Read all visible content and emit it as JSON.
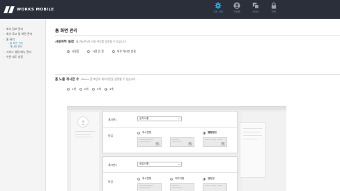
{
  "header": {
    "brand": "WORKS MOBILE",
    "nav": [
      {
        "label": "기본 관리",
        "icon": "gear-icon",
        "active": true
      },
      {
        "label": "구성원",
        "icon": "user-icon",
        "active": false
      },
      {
        "label": "서비스",
        "icon": "service-icon",
        "active": false
      },
      {
        "label": "보안",
        "icon": "lock-icon",
        "active": false
      }
    ]
  },
  "sidebar": {
    "items": [
      {
        "label": "회사 정보 관리"
      },
      {
        "label": "회사 로고 및 화면 관리"
      },
      {
        "label": "홈 관리"
      },
      {
        "label": "서비스 설정 메뉴 관리"
      },
      {
        "label": "약관 내도 설정"
      }
    ],
    "sub_items": [
      {
        "label": "홈 화면 관리",
        "active": true
      },
      {
        "label": "게시판 관리",
        "active": false
      }
    ]
  },
  "main": {
    "title": "홈 화면 관리",
    "section_usage": {
      "title": "사용여부 설정",
      "desc": "홈(게시판)의 사용 여부를 설정할 수 있습니다.",
      "options": [
        {
          "label": "사용함",
          "selected": true
        },
        {
          "label": "사용 안 함",
          "selected": false
        },
        {
          "label": "외부 게시판 연결",
          "selected": false
        }
      ]
    },
    "section_count": {
      "title": "홈 노출 게시판 수",
      "desc": "Works 홈 화면의 레이아웃을 설정할 수 있습니다.",
      "options": [
        {
          "label": "1개",
          "selected": false
        },
        {
          "label": "2개",
          "selected": false
        },
        {
          "label": "3개",
          "selected": false
        },
        {
          "label": "4개",
          "selected": true
        }
      ]
    },
    "boards": [
      {
        "label": "게시판1",
        "selected_value": "공지사항",
        "type_label": "타입",
        "types": [
          {
            "label": "게시판형",
            "selected": false
          },
          {
            "label": "이미지형",
            "selected": false
          },
          {
            "label": "앨범형",
            "selected": true
          }
        ]
      },
      {
        "label": "게시판2",
        "selected_value": "공유사항",
        "type_label": "타입",
        "types": [
          {
            "label": "게시판형",
            "selected": false
          },
          {
            "label": "이미지형",
            "selected": false
          },
          {
            "label": "앨범형",
            "selected": true
          }
        ]
      }
    ]
  },
  "colors": {
    "topbar": "#2b2f3a",
    "accent": "#2fa8e8",
    "sidebar_bg": "#f4f4f4"
  }
}
